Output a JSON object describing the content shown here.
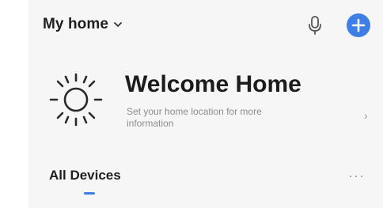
{
  "header": {
    "home_title": "My home",
    "chevron_icon": "chevron-down-icon",
    "mic_icon": "microphone-icon",
    "add_icon": "plus-icon",
    "accent_color": "#3d7fe6"
  },
  "welcome": {
    "icon": "sun-icon",
    "title": "Welcome Home",
    "subtitle": "Set your home location for more information",
    "arrow": "›"
  },
  "devices": {
    "tab_label": "All Devices",
    "more_label": "···"
  }
}
